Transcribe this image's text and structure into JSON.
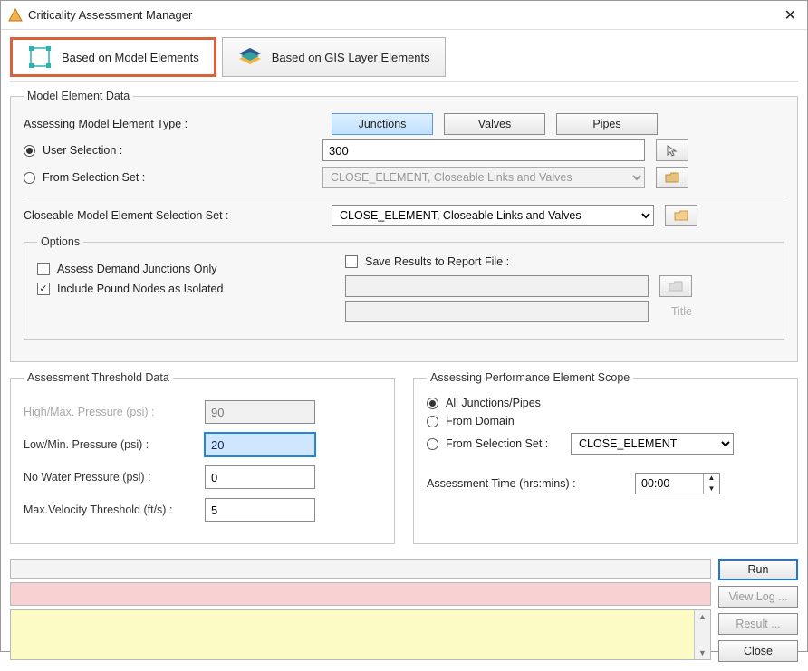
{
  "window": {
    "title": "Criticality Assessment Manager"
  },
  "tabs": {
    "model": "Based on Model Elements",
    "gis": "Based on GIS Layer Elements"
  },
  "modelData": {
    "legend": "Model Element Data",
    "assessType": "Assessing Model Element Type :",
    "btnJunctions": "Junctions",
    "btnValves": "Valves",
    "btnPipes": "Pipes",
    "userSel": "User Selection :",
    "userSelValue": "300",
    "fromSet": "From Selection Set :",
    "fromSetValue": "CLOSE_ELEMENT, Closeable Links and Valves",
    "closeableLabel": "Closeable Model Element Selection Set :",
    "closeableValue": "CLOSE_ELEMENT, Closeable Links and Valves"
  },
  "options": {
    "legend": "Options",
    "assessDemand": "Assess Demand Junctions Only",
    "includePound": "Include Pound Nodes as Isolated",
    "saveResults": "Save Results to Report File :",
    "titleLabel": "Title"
  },
  "threshold": {
    "legend": "Assessment Threshold Data",
    "highLabel": "High/Max. Pressure (psi) :",
    "highVal": "90",
    "lowLabel": "Low/Min. Pressure (psi) :",
    "lowVal": "20",
    "noWaterLabel": "No Water Pressure (psi) :",
    "noWaterVal": "0",
    "maxVelLabel": "Max.Velocity Threshold (ft/s) :",
    "maxVelVal": "5"
  },
  "scope": {
    "legend": "Assessing Performance Element Scope",
    "all": "All Junctions/Pipes",
    "domain": "From Domain",
    "fromSet": "From Selection Set :",
    "fromSetValue": "CLOSE_ELEMENT",
    "timeLabel": "Assessment Time (hrs:mins) :",
    "timeValue": "00:00"
  },
  "buttons": {
    "run": "Run",
    "viewLog": "View Log ...",
    "result": "Result ...",
    "close": "Close"
  }
}
